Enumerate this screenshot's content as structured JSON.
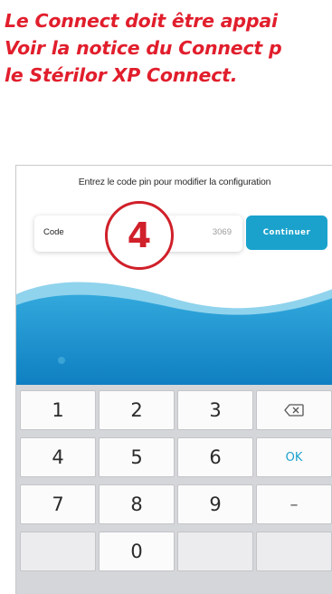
{
  "heading": {
    "line1": "Le Connect doit être appai",
    "line2": "Voir la notice du Connect p",
    "line3": "le Stérilor XP Connect."
  },
  "screen": {
    "instruction": "Entrez le code pin pour modifier la configuration",
    "code_label": "Code",
    "code_value": "3069",
    "continue_label": "Continuer",
    "step_number": "4"
  },
  "keypad": {
    "keys": [
      "1",
      "2",
      "3",
      "",
      "4",
      "5",
      "6",
      "OK",
      "7",
      "8",
      "9",
      "–",
      "",
      "0",
      "",
      ""
    ],
    "backspace_icon": "backspace-icon"
  },
  "colors": {
    "heading_red": "#e11e2c",
    "step_red": "#d0202a",
    "accent_blue": "#1aa2cc",
    "wave_blue": "#1e8fcf",
    "keypad_bg": "#d5d6da"
  }
}
